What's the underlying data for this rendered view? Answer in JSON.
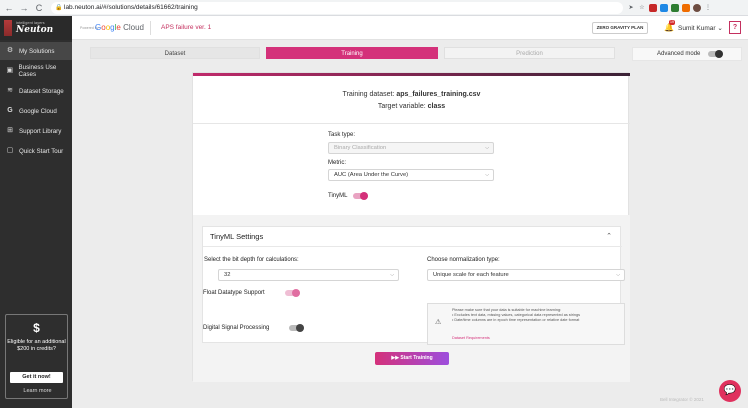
{
  "browser": {
    "url": "lab.neuton.ai/#/solutions/details/61662/training",
    "nav": [
      "←",
      "→",
      "C"
    ],
    "icons": [
      "share-icon",
      "star-icon",
      "extension-icon",
      "profile-icon"
    ]
  },
  "header": {
    "brand_tag": "intelligent layers",
    "brand_name": "Neuton",
    "gc_prefix": "Powered by",
    "gc_logo": "Google Cloud",
    "project_name": "APS failure ver. 1",
    "plan_button": "ZERO GRAVITY PLAN",
    "notification_count": "19",
    "user_name": "Sumit Kumar ⌄",
    "help_label": "?"
  },
  "sidebar": {
    "items": [
      {
        "label": "My Solutions",
        "icon": "gear-icon"
      },
      {
        "label": "Business Use Cases",
        "icon": "briefcase-icon"
      },
      {
        "label": "Dataset Storage",
        "icon": "database-icon"
      },
      {
        "label": "Google Cloud",
        "icon": "google-icon"
      },
      {
        "label": "Support Library",
        "icon": "book-icon"
      },
      {
        "label": "Quick Start Tour",
        "icon": "tour-icon"
      }
    ],
    "promo": {
      "symbol": "$",
      "text": "Eligible for an additional $200 in credits?",
      "button": "Get it now!",
      "link": "Learn more"
    }
  },
  "steps": [
    "Dataset",
    "Training",
    "Prediction"
  ],
  "advanced_mode": "Advanced mode",
  "card": {
    "dataset_label": "Training dataset:",
    "dataset_file": "aps_failures_training.csv",
    "target_label": "Target variable:",
    "target_value": "class",
    "task_type_label": "Task type:",
    "task_type_value": "Binary Classification",
    "metric_label": "Metric:",
    "metric_value": "AUC (Area Under the Curve)",
    "tinyml_label": "TinyML"
  },
  "tinyml": {
    "title": "TinyML Settings",
    "bit_depth_label": "Select the bit depth for calculations:",
    "bit_depth_value": "32",
    "norm_label": "Choose normalization type:",
    "norm_value": "Unique scale for each feature",
    "float_label": "Float Datatype Support",
    "dsp_label": "Digital Signal Processing",
    "warning_intro": "Please make sure that your data is suitable for machine learning:",
    "warning_items": [
      "Excludes text data, missing values, categorical data represented as strings",
      "Date/time columns are in epoch time representation or relative date format"
    ],
    "warning_link": "Dataset Requirements"
  },
  "start_button": "▶▶ Start Training",
  "footer": "Bell Integrator © 2021"
}
